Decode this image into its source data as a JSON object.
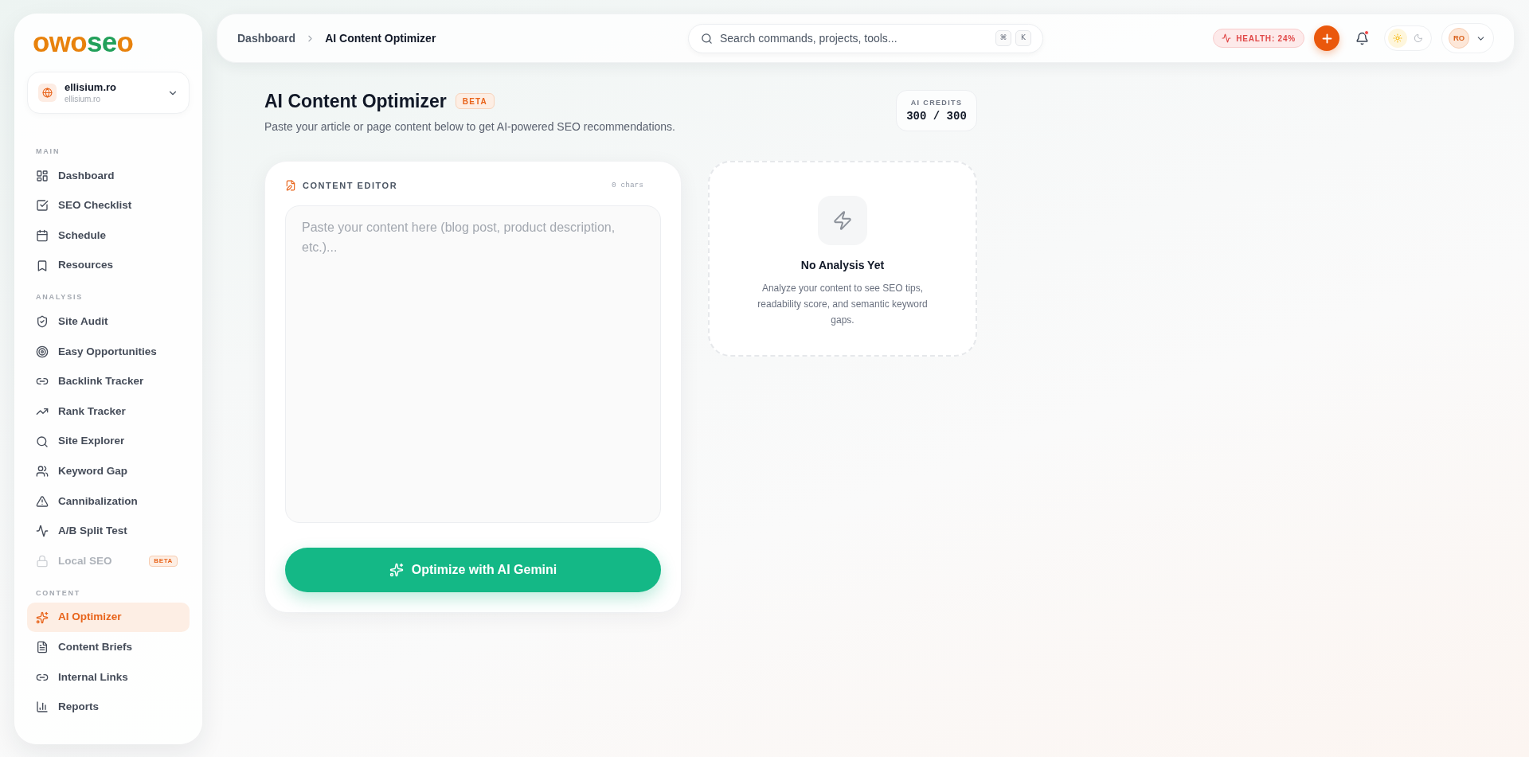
{
  "sidebar": {
    "logo": {
      "lead": "owo",
      "accent": "se",
      "tail": "o"
    },
    "project": {
      "name": "ellisium.ro",
      "domain": "ellisium.ro"
    },
    "sections": [
      {
        "title": "MAIN",
        "items": [
          {
            "label": "Dashboard",
            "selected": false,
            "disabled": false
          },
          {
            "label": "SEO Checklist",
            "selected": false,
            "disabled": false
          },
          {
            "label": "Schedule",
            "selected": false,
            "disabled": false
          },
          {
            "label": "Resources",
            "selected": false,
            "disabled": false
          }
        ]
      },
      {
        "title": "ANALYSIS",
        "items": [
          {
            "label": "Site Audit",
            "selected": false,
            "disabled": false
          },
          {
            "label": "Easy Opportunities",
            "selected": false,
            "disabled": false
          },
          {
            "label": "Backlink Tracker",
            "selected": false,
            "disabled": false
          },
          {
            "label": "Rank Tracker",
            "selected": false,
            "disabled": false
          },
          {
            "label": "Site Explorer",
            "selected": false,
            "disabled": false
          },
          {
            "label": "Keyword Gap",
            "selected": false,
            "disabled": false
          },
          {
            "label": "Cannibalization",
            "selected": false,
            "disabled": false
          },
          {
            "label": "A/B Split Test",
            "selected": false,
            "disabled": false
          },
          {
            "label": "Local SEO",
            "selected": false,
            "disabled": true,
            "badge": "BETA"
          }
        ]
      },
      {
        "title": "CONTENT",
        "items": [
          {
            "label": "AI Optimizer",
            "selected": true,
            "disabled": false
          },
          {
            "label": "Content Briefs",
            "selected": false,
            "disabled": false
          },
          {
            "label": "Internal Links",
            "selected": false,
            "disabled": false
          },
          {
            "label": "Reports",
            "selected": false,
            "disabled": false
          }
        ]
      }
    ]
  },
  "topbar": {
    "breadcrumb": [
      {
        "label": "Dashboard",
        "current": false
      },
      {
        "label": "AI Content Optimizer",
        "current": true
      }
    ],
    "search": {
      "placeholder": "Search commands, projects, tools...",
      "shortcut": [
        "⌘",
        "K"
      ]
    },
    "health": {
      "label": "HEALTH: 24%"
    },
    "notifications": {
      "unread": true
    },
    "theme": [
      {
        "selected": true
      },
      {
        "selected": false
      }
    ],
    "user": {
      "initials": "RO"
    }
  },
  "page": {
    "title": "AI Content Optimizer",
    "badge": "BETA",
    "subtitle": "Paste your article or page content below to get AI-powered SEO recommendations.",
    "credits": {
      "label": "AI CREDITS",
      "value": "300 / 300"
    }
  },
  "editor": {
    "title": "CONTENT EDITOR",
    "count": "0 chars",
    "placeholder": "Paste your content here (blog post, product description, etc.)...",
    "button": "Optimize with AI Gemini"
  },
  "analysis": {
    "title": "No Analysis Yet",
    "description": "Analyze your content to see SEO tips, readability score, and semantic keyword gaps."
  }
}
